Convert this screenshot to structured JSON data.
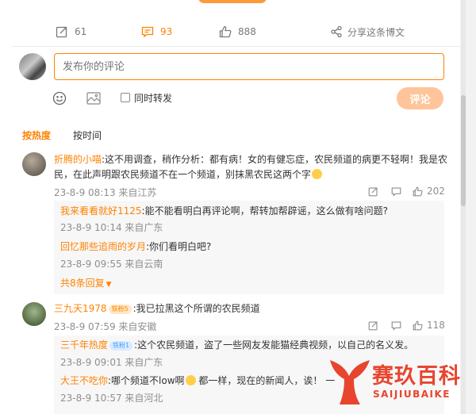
{
  "actions": {
    "repost_count": "61",
    "comment_count": "93",
    "like_count": "888",
    "share_label": "分享这条博文"
  },
  "compose": {
    "placeholder": "发布你的评论",
    "repost_label": "同时转发",
    "submit_label": "评论"
  },
  "sort": {
    "hot": "按热度",
    "time": "按时间"
  },
  "comments": [
    {
      "user": "折腾的小喵",
      "text_line1": ":这不用调查，稍作分析：都有病！女的有健忘症，农民频道的病更不轻啊！我是农",
      "text_line2": "民，在此声明跟农民频道不在一个频道，别抹黑农民这两个字",
      "meta": "23-8-9 08:13 来自江苏",
      "likes": "202",
      "replies": [
        {
          "user": "我来看看就好1125",
          "text": ":能不能看明白再评论啊，帮转加帮辟谣，这么做有啥问题?",
          "meta": "23-8-9 10:14 来自广东"
        },
        {
          "user": "回忆那些追雨的岁月",
          "text": ":你们看明白吧?",
          "meta": "23-8-9 09:55 来自云南"
        }
      ],
      "more_replies": "共8条回复"
    },
    {
      "user": "三九天1978",
      "badge": "铁粉5",
      "text": ":我已拉黑这个所谓的农民频道",
      "meta": "23-8-9 07:59 来自安徽",
      "likes": "118",
      "replies": [
        {
          "user": "三千年热度",
          "badge": "铁粉1",
          "text": ":这个农民频道，盗了一些网友发能猫经典视频，以自己的名义发。",
          "meta": "23-8-9 09:01 来自广东"
        },
        {
          "user": "大王不吃你",
          "text_a": ":哪个频道不low啊",
          "text_b": " 都一样，现在的新闻人，诶！ 一",
          "meta": "23-8-9 10:57 来自河北"
        }
      ]
    }
  ],
  "watermark": {
    "title": "赛玖百科",
    "subtitle": "SAIJIUBAIKE"
  },
  "colors": {
    "accent": "#ff8200",
    "submit_disabled": "#ffc49a",
    "watermark": "#e8452e"
  }
}
